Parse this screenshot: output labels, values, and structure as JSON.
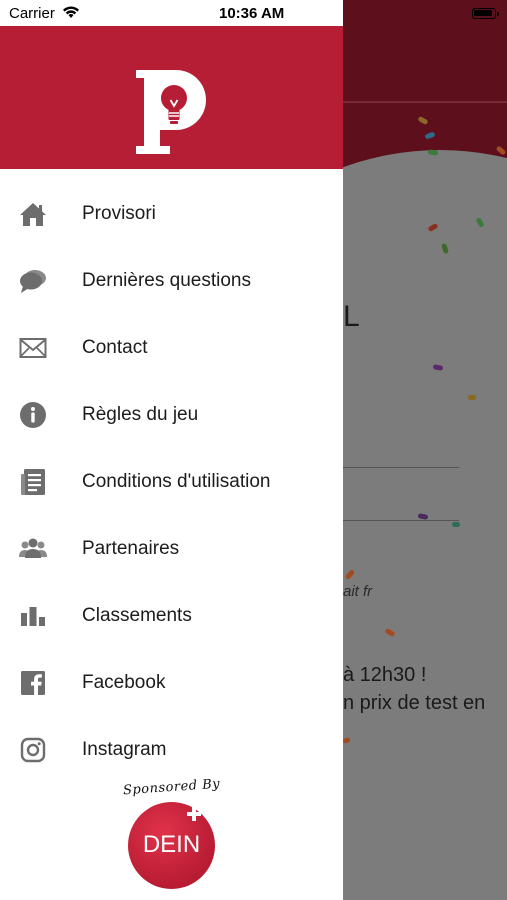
{
  "status_bar": {
    "carrier": "Carrier",
    "time": "10:36 AM"
  },
  "menu": {
    "items": [
      {
        "label": "Provisori",
        "icon": "home-icon"
      },
      {
        "label": "Dernières questions",
        "icon": "chat-bubbles-icon"
      },
      {
        "label": "Contact",
        "icon": "envelope-icon"
      },
      {
        "label": "Règles du jeu",
        "icon": "info-icon"
      },
      {
        "label": "Conditions d'utilisation",
        "icon": "document-icon"
      },
      {
        "label": "Partenaires",
        "icon": "people-icon"
      },
      {
        "label": "Classements",
        "icon": "bar-chart-icon"
      },
      {
        "label": "Facebook",
        "icon": "facebook-icon"
      },
      {
        "label": "Instagram",
        "icon": "instagram-icon"
      }
    ]
  },
  "sponsor": {
    "caption": "Sponsored By",
    "name": "DEIN"
  },
  "background": {
    "heading_fragment": "L",
    "italic_fragment": "ait fr",
    "line1": "à 12h30 !",
    "line2": "n prix de test en"
  },
  "colors": {
    "brand_red": "#b61e36",
    "icon_gray": "#6d6d6d",
    "text": "#1c1c1c"
  }
}
